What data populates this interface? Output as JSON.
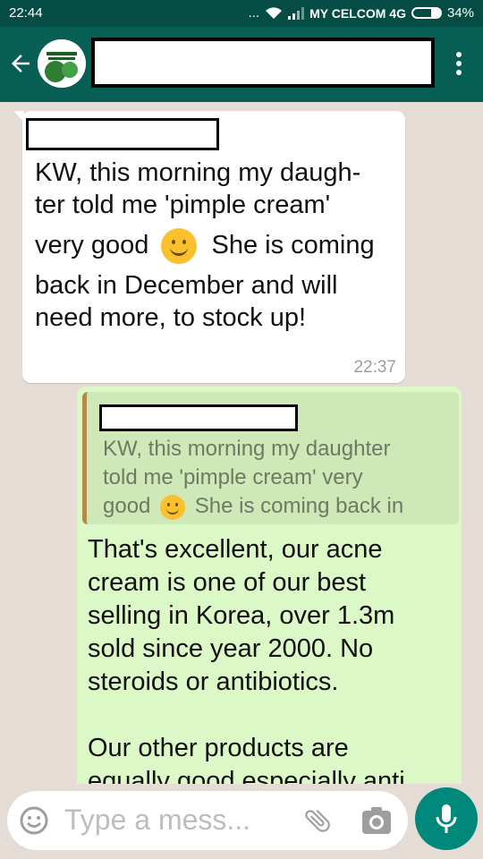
{
  "status_bar": {
    "time": "22:44",
    "dots": "...",
    "carrier": "MY CELCOM 4G",
    "battery": "34%",
    "battery_level": 0.34
  },
  "header": {
    "contact_name": "",
    "back_icon": "arrow-left-icon",
    "menu_icon": "more-vertical-icon"
  },
  "messages": [
    {
      "direction": "incoming",
      "line1": "KW, this morning my daugh-",
      "line2": "ter told me 'pimple cream'",
      "line3a": "very good",
      "line3b": "She is coming",
      "line4": "back in December and will",
      "line5": "need more, to stock up!",
      "time": "22:37"
    },
    {
      "direction": "outgoing",
      "quote_line1": "KW, this morning my daughter",
      "quote_line2": "told me 'pimple cream' very",
      "quote_line3a": "good",
      "quote_line3b": "She is coming back in",
      "text": "That's excellent, our acne\ncream is one of our best\nselling in Korea, over 1.3m\nsold since year 2000. No\nsteroids or antibiotics.\n\nOur other products are\nequally good especially anti"
    }
  ],
  "input": {
    "placeholder": "Type a mess..."
  },
  "colors": {
    "header": "#075e54",
    "status_bar": "#054d44",
    "chat_bg": "#e5ddd5",
    "outgoing_bubble": "#dcf8c6",
    "mic_button": "#00897b"
  }
}
